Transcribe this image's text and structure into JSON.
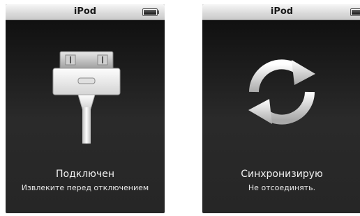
{
  "screens": [
    {
      "title": "iPod",
      "status_icon": "battery-icon",
      "graphic": "dock-connector-icon",
      "message": "Подключен",
      "submessage": "Извлеките перед отключением"
    },
    {
      "title": "iPod",
      "status_icon": "battery-icon",
      "graphic": "sync-arrows-icon",
      "message": "Синхронизирую",
      "submessage": "Не отсоединять."
    }
  ]
}
